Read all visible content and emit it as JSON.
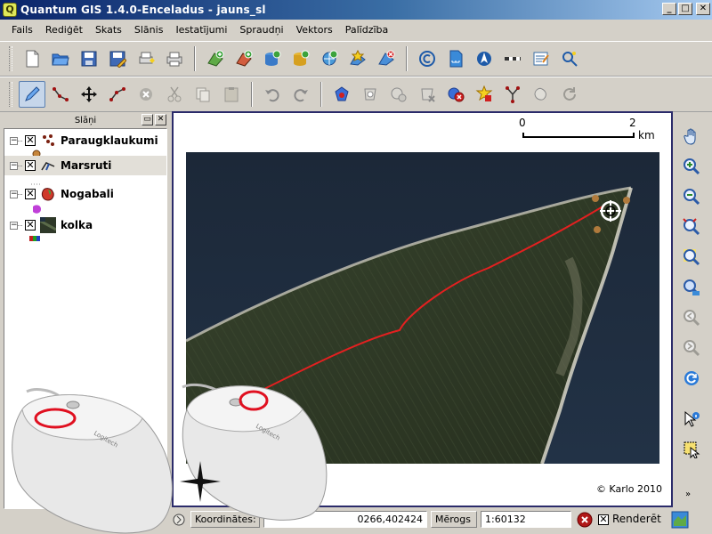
{
  "window": {
    "title": "Quantum GIS 1.4.0-Enceladus - jauns_sl",
    "app_icon": "Q",
    "buttons": {
      "minimize": "_",
      "maximize": "□",
      "close": "✕"
    }
  },
  "menu": [
    "Fails",
    "Rediģēt",
    "Skats",
    "Slānis",
    "Iestatījumi",
    "Spraudņi",
    "Vektors",
    "Palīdzība"
  ],
  "toolbar_file_icons": [
    "new-project-icon",
    "open-project-icon",
    "save-project-icon",
    "save-as-icon",
    "print-composer-icon",
    "print-icon"
  ],
  "toolbar_layer_icons": [
    "add-vector-layer-icon",
    "add-raster-layer-icon",
    "add-postgis-layer-icon",
    "add-spatialite-layer-icon",
    "add-wms-layer-icon",
    "new-vector-layer-icon",
    "remove-layer-icon"
  ],
  "toolbar_plugin_icons": [
    "copyright-label-icon",
    "north-arrow-icon",
    "scalebar-icon",
    "georeferencer-icon",
    "gps-tools-icon"
  ],
  "toolbar_digitize_icons": [
    "toggle-editing-icon",
    "capture-line-icon",
    "move-feature-icon",
    "node-tool-icon",
    "delete-selected-icon",
    "cut-features-icon",
    "copy-features-icon",
    "paste-features-icon",
    "undo-icon",
    "redo-icon",
    "simplify-feature-icon",
    "add-ring-icon",
    "add-island-icon",
    "delete-ring-icon",
    "delete-part-icon",
    "reshape-features-icon",
    "split-features-icon",
    "merge-features-icon",
    "rotate-label-icon",
    "rotate-point-icon"
  ],
  "layers_panel": {
    "title": "Slāņi",
    "layers": [
      {
        "name": "Paraugklaukumi",
        "checked": "✕",
        "expander": "−",
        "selected": false
      },
      {
        "name": "Marsruti",
        "checked": "✕",
        "expander": "−",
        "selected": true
      },
      {
        "name": "Nogabali",
        "checked": "✕",
        "expander": "−",
        "selected": false
      },
      {
        "name": "kolka",
        "checked": "✕",
        "expander": "−",
        "selected": false
      }
    ]
  },
  "map": {
    "scalebar": {
      "left_label": "0",
      "right_label": "2",
      "unit": "km"
    },
    "copyright": "© Karlo 2010"
  },
  "right_toolbar_icons": [
    "pan-icon",
    "zoom-in-icon",
    "zoom-out-icon",
    "zoom-full-icon",
    "zoom-to-selection-icon",
    "zoom-to-layer-icon",
    "zoom-last-icon",
    "zoom-next-icon",
    "refresh-icon",
    "identify-icon",
    "select-features-icon"
  ],
  "statusbar": {
    "coordinates_label": "Koordinātes:",
    "coordinates_value": "0266,402424",
    "scale_label": "Mērogs",
    "scale_value": "1:60132",
    "render_label": "Renderēt",
    "render_checked": "✕"
  },
  "colors": {
    "title_bar": "#0a246a",
    "route_line": "#e32020",
    "mouse_highlight": "#e01020",
    "sea": "#1b2c3e",
    "land": "#2f3a26"
  }
}
